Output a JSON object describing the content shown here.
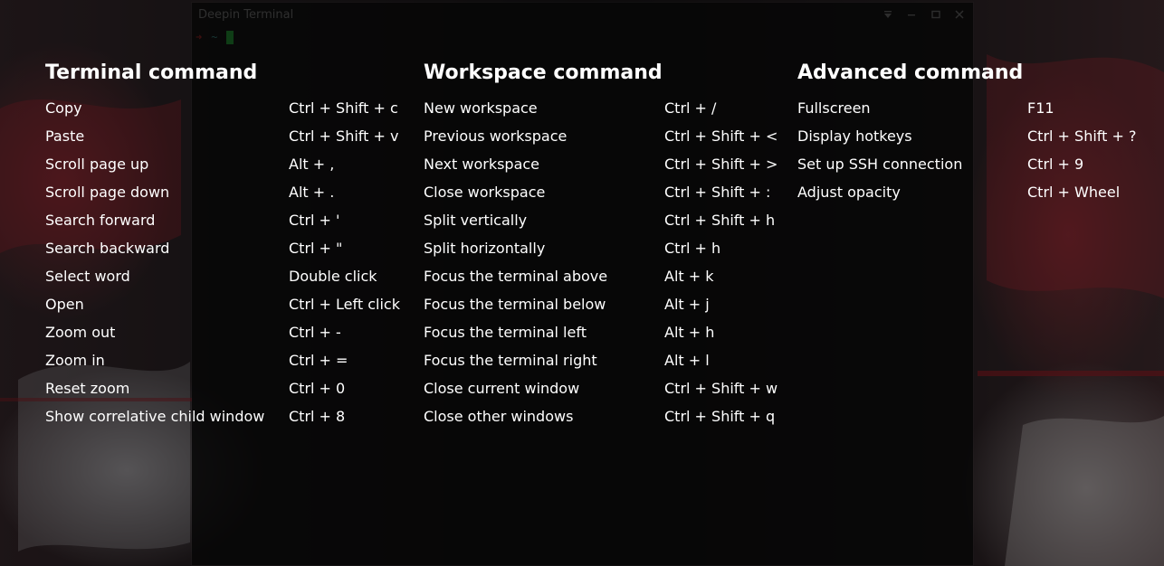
{
  "window": {
    "title": "Deepin Terminal",
    "controls": [
      {
        "name": "menu-icon"
      },
      {
        "name": "minimize-icon"
      },
      {
        "name": "maximize-icon"
      },
      {
        "name": "close-icon"
      }
    ]
  },
  "prompt": {
    "arrow": "➜",
    "cwd": "~"
  },
  "hotkeys": {
    "terminal": {
      "title": "Terminal command",
      "items": [
        {
          "label": "Copy",
          "keys": "Ctrl + Shift + c"
        },
        {
          "label": "Paste",
          "keys": "Ctrl + Shift + v"
        },
        {
          "label": "Scroll page up",
          "keys": "Alt + ,"
        },
        {
          "label": "Scroll page down",
          "keys": "Alt + ."
        },
        {
          "label": "Search forward",
          "keys": "Ctrl + '"
        },
        {
          "label": "Search backward",
          "keys": "Ctrl + \""
        },
        {
          "label": "Select word",
          "keys": "Double click"
        },
        {
          "label": "Open",
          "keys": "Ctrl + Left click"
        },
        {
          "label": "Zoom out",
          "keys": "Ctrl + -"
        },
        {
          "label": "Zoom in",
          "keys": "Ctrl + ="
        },
        {
          "label": "Reset zoom",
          "keys": "Ctrl + 0"
        },
        {
          "label": "Show correlative child window",
          "keys": "Ctrl + 8"
        }
      ]
    },
    "workspace": {
      "title": "Workspace command",
      "items": [
        {
          "label": "New workspace",
          "keys": "Ctrl + /"
        },
        {
          "label": "Previous workspace",
          "keys": "Ctrl + Shift + <"
        },
        {
          "label": "Next workspace",
          "keys": "Ctrl + Shift + >"
        },
        {
          "label": "Close workspace",
          "keys": "Ctrl + Shift + :"
        },
        {
          "label": "Split vertically",
          "keys": "Ctrl + Shift + h"
        },
        {
          "label": "Split horizontally",
          "keys": "Ctrl + h"
        },
        {
          "label": "Focus the terminal above",
          "keys": "Alt + k"
        },
        {
          "label": "Focus the terminal below",
          "keys": "Alt + j"
        },
        {
          "label": "Focus the terminal left",
          "keys": "Alt + h"
        },
        {
          "label": "Focus the terminal right",
          "keys": "Alt + l"
        },
        {
          "label": "Close current window",
          "keys": "Ctrl + Shift + w"
        },
        {
          "label": "Close other windows",
          "keys": "Ctrl + Shift + q"
        }
      ]
    },
    "advanced": {
      "title": "Advanced command",
      "items": [
        {
          "label": "Fullscreen",
          "keys": "F11"
        },
        {
          "label": "Display hotkeys",
          "keys": "Ctrl + Shift + ?"
        },
        {
          "label": "Set up SSH connection",
          "keys": "Ctrl + 9"
        },
        {
          "label": "Adjust opacity",
          "keys": "Ctrl + Wheel"
        }
      ]
    }
  },
  "colors": {
    "overlay_text": "#ffffff",
    "title_text": "#5f5f5f",
    "cursor": "#1f7a2c",
    "prompt_arrow": "#7a1e1e",
    "prompt_cwd": "#2f6a66"
  }
}
